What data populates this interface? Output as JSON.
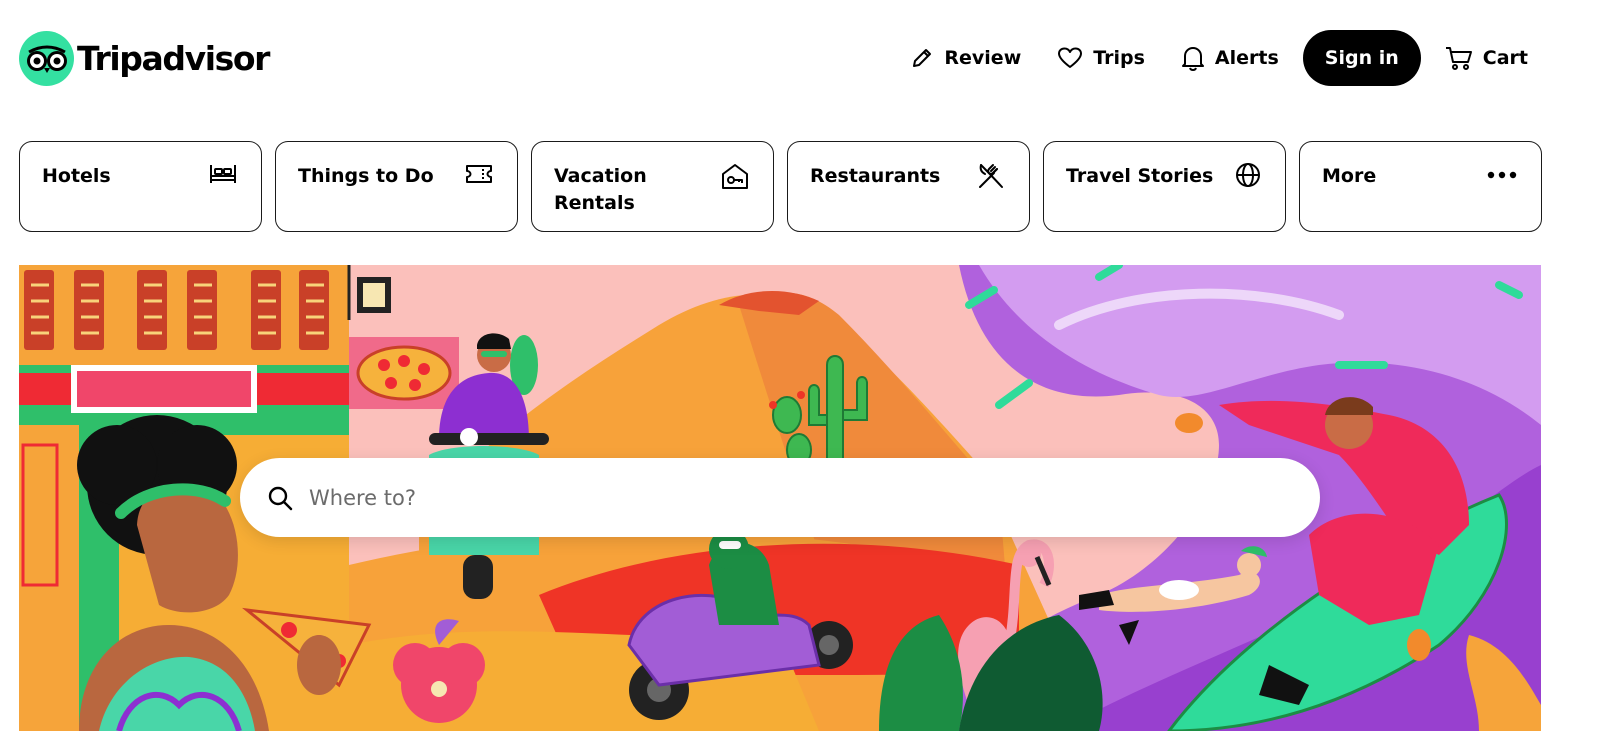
{
  "header": {
    "brand": "Tripadvisor",
    "nav": [
      {
        "label": "Review",
        "icon": "pencil-icon"
      },
      {
        "label": "Trips",
        "icon": "heart-icon"
      },
      {
        "label": "Alerts",
        "icon": "bell-icon"
      }
    ],
    "signin_label": "Sign in",
    "cart_label": "Cart"
  },
  "categories": [
    {
      "label": "Hotels",
      "icon": "bed-icon"
    },
    {
      "label": "Things to Do",
      "icon": "ticket-icon"
    },
    {
      "label": "Vacation Rentals",
      "icon": "house-key-icon"
    },
    {
      "label": "Restaurants",
      "icon": "fork-knife-icon"
    },
    {
      "label": "Travel Stories",
      "icon": "globe-icon"
    },
    {
      "label": "More",
      "icon": "more-dots-icon"
    }
  ],
  "search": {
    "placeholder": "Where to?"
  },
  "colors": {
    "brand": "#34e0a1",
    "black": "#000000"
  }
}
